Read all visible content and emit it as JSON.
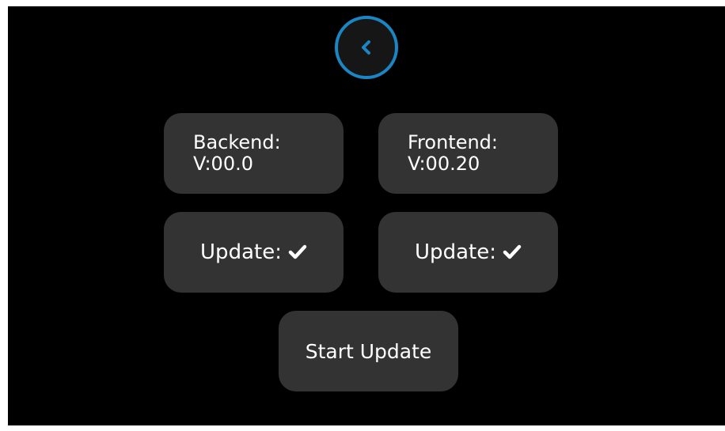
{
  "back": {
    "icon": "chevron-left-icon"
  },
  "backend": {
    "label": "Backend:",
    "version": "V:00.0"
  },
  "frontend": {
    "label": "Frontend:",
    "version": "V:00.20"
  },
  "backend_update": {
    "label": "Update:",
    "icon": "checkmark-icon",
    "checked": true
  },
  "frontend_update": {
    "label": "Update:",
    "icon": "checkmark-icon",
    "checked": true
  },
  "actions": {
    "start_update": "Start Update"
  },
  "colors": {
    "accent": "#1b86c4",
    "card_bg": "#333333",
    "screen_bg": "#000000",
    "text": "#ffffff"
  }
}
